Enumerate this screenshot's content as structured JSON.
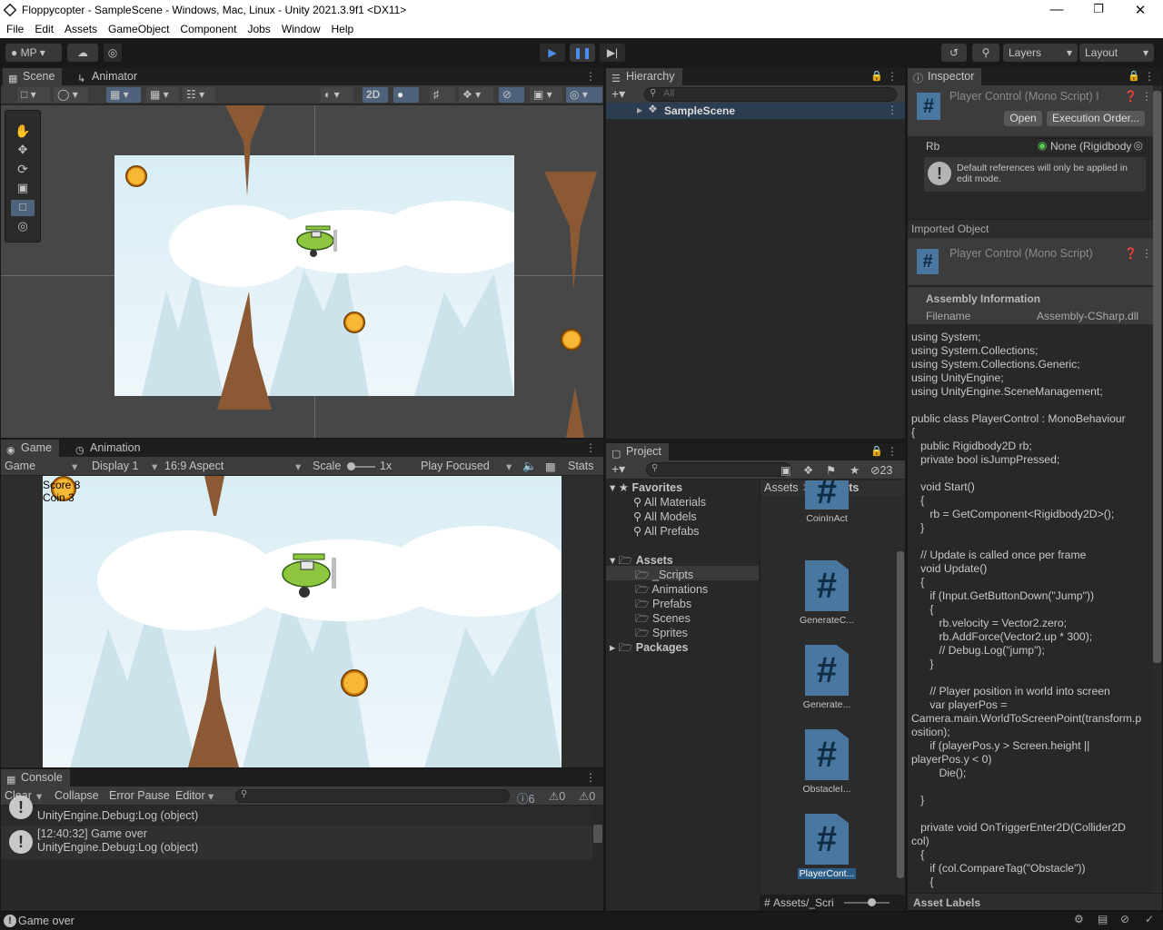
{
  "window": {
    "title": "Floppycopter - SampleScene - Windows, Mac, Linux - Unity 2021.3.9f1 <DX11>"
  },
  "menu": [
    "File",
    "Edit",
    "Assets",
    "GameObject",
    "Component",
    "Jobs",
    "Window",
    "Help"
  ],
  "toolbar": {
    "account": "MP",
    "layers": "Layers",
    "layout": "Layout"
  },
  "scene": {
    "tab_scene": "Scene",
    "tab_animator": "Animator",
    "mode_2d": "2D"
  },
  "game": {
    "tab_game": "Game",
    "tab_animation": "Animation",
    "view": "Game",
    "display": "Display 1",
    "aspect": "16:9 Aspect",
    "scale_label": "Scale",
    "scale_value": "1x",
    "play_mode": "Play Focused",
    "stats": "Stats",
    "score": "Score 8",
    "coin": "Coin 3"
  },
  "hierarchy": {
    "title": "Hierarchy",
    "search_placeholder": "All",
    "scene": "SampleScene"
  },
  "project": {
    "title": "Project",
    "hidden_count": "23",
    "favorites_label": "Favorites",
    "favorites": [
      "All Materials",
      "All Models",
      "All Prefabs"
    ],
    "assets_label": "Assets",
    "folders": [
      "_Scripts",
      "Animations",
      "Prefabs",
      "Scenes",
      "Sprites"
    ],
    "packages_label": "Packages",
    "breadcrumb_root": "Assets",
    "breadcrumb_sep": ">",
    "breadcrumb_current": "_Scripts",
    "scripts": [
      "CoinInAct",
      "GenerateC...",
      "Generate...",
      "ObstacleI...",
      "PlayerCont..."
    ],
    "footer_path": "Assets/_Scri"
  },
  "inspector": {
    "title": "Inspector",
    "script_title": "Player Control (Mono Script) I",
    "open": "Open",
    "execution_order": "Execution Order...",
    "rb_label": "Rb",
    "rb_value": "None (Rigidbody",
    "info": "Default references will only be applied in edit mode.",
    "imported_object": "Imported Object",
    "imported_title": "Player Control (Mono Script)",
    "assembly_info": "Assembly Information",
    "filename_label": "Filename",
    "filename_value": "Assembly-CSharp.dll",
    "code": [
      "using System;",
      "using System.Collections;",
      "using System.Collections.Generic;",
      "using UnityEngine;",
      "using UnityEngine.SceneManagement;",
      "",
      "public class PlayerControl : MonoBehaviour",
      "{",
      "   public Rigidbody2D rb;",
      "   private bool isJumpPressed;",
      "",
      "   void Start()",
      "   {",
      "      rb = GetComponent<Rigidbody2D>();",
      "   }",
      "",
      "   // Update is called once per frame",
      "   void Update()",
      "   {",
      "      if (Input.GetButtonDown(\"Jump\"))",
      "      {",
      "         rb.velocity = Vector2.zero;",
      "         rb.AddForce(Vector2.up * 300);",
      "         // Debug.Log(\"jump\");",
      "      }",
      "",
      "      // Player position in world into screen",
      "      var playerPos =",
      "Camera.main.WorldToScreenPoint(transform.p",
      "osition);",
      "      if (playerPos.y > Screen.height ||",
      "playerPos.y < 0)",
      "         Die();",
      "",
      "   }",
      "",
      "   private void OnTriggerEnter2D(Collider2D",
      "col)",
      "   {",
      "      if (col.CompareTag(\"Obstacle\"))",
      "      {"
    ],
    "asset_labels": "Asset Labels"
  },
  "console": {
    "title": "Console",
    "clear": "Clear",
    "collapse": "Collapse",
    "error_pause": "Error Pause",
    "editor": "Editor",
    "log_count": "6",
    "warn_count": "0",
    "error_count": "0",
    "row1_line2": "UnityEngine.Debug:Log (object)",
    "row2_line1": "[12:40:32] Game over",
    "row2_line2": "UnityEngine.Debug:Log (object)"
  },
  "status": {
    "message": "Game over"
  }
}
